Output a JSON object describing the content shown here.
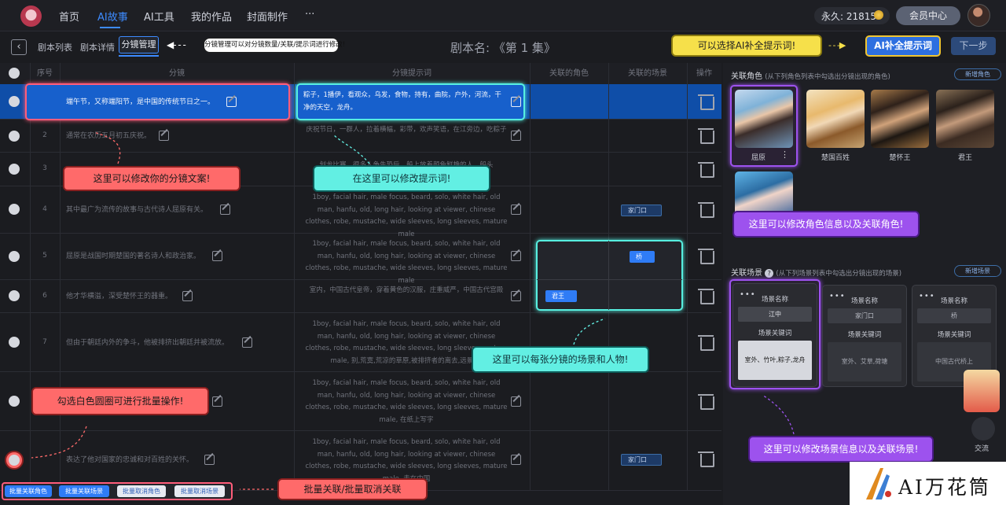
{
  "nav": {
    "items": [
      "首页",
      "AI故事",
      "AI工具",
      "我的作品",
      "封面制作",
      "···"
    ],
    "active_index": 1,
    "credits": "永久: 21815",
    "member_button": "会员中心"
  },
  "subnav": {
    "tabs": [
      "剧本列表",
      "剧本详情",
      "分镜管理"
    ],
    "active_tab": "分镜管理",
    "script_title": "剧本名: 《第 1 集》",
    "ai_button": "AI补全提示词",
    "next_button": "下一步"
  },
  "table": {
    "headers": [
      "序号",
      "分镜",
      "分镜提示词",
      "关联的角色",
      "关联的场景",
      "操作"
    ],
    "rows": [
      {
        "no": "1",
        "text": "端午节，又称端阳节，是中国的传统节日之一。",
        "prompt": "粽子，1播伊，看观众，乌发，食物，持有，曲院，户外，河流，干净的天空，龙舟。",
        "selected": true
      },
      {
        "no": "2",
        "text": "通常在农历五月初五庆祝。",
        "prompt": "庆祝节日，一群人，拉着横幅，彩带，欢声笑语，在江旁边，吃粽子"
      },
      {
        "no": "3",
        "text": "",
        "prompt": "划龙比赛，很多人争先恐后，船上放着颜色鲜艳的人，船头"
      },
      {
        "no": "4",
        "text": "其中最广为流传的故事与古代诗人屈原有关。",
        "prompt": "1boy, facial hair, male focus, beard, solo, white hair, old man, hanfu, old, long hair, looking at viewer, chinese clothes, robe, mustache, wide sleeves, long sleeves, mature male",
        "scene": "家门口"
      },
      {
        "no": "5",
        "text": "屈原是战国时期楚国的著名诗人和政治家。",
        "prompt": "1boy, facial hair, male focus, beard, solo, white hair, old man, hanfu, old, long hair, looking at viewer, chinese clothes, robe, mustache, wide sleeves, long sleeves, mature male",
        "scene": "桥"
      },
      {
        "no": "6",
        "text": "他才华横溢，深受楚怀王的器重。",
        "prompt": "室内，中国古代皇帝，穿着黄色的汉服，庄重威严，中国古代宫殿",
        "role": "君王"
      },
      {
        "no": "7",
        "text": "但由于朝廷内外的争斗，他被排挤出朝廷并被流放。",
        "prompt": "1boy, facial hair, male focus, beard, solo, white hair, old man, hanfu, old, long hair, looking at viewer, chinese clothes, robe, mustache, wide sleeves, long sleeves, mature male, 别,荒寞,荒凉的草原,被排挤者的离去,远景,昏"
      },
      {
        "no": "8",
        "text": "",
        "prompt": "1boy, facial hair, male focus, beard, solo, white hair, old man, hanfu, old, long hair, looking at viewer, chinese clothes, robe, mustache, wide sleeves, long sleeves, mature male, 在纸上写字"
      },
      {
        "no": "",
        "text": "表达了他对国家的忠诚和对百姓的关怀。",
        "prompt": "1boy, facial hair, male focus, beard, solo, white hair, old man, hanfu, old, long hair, looking at viewer, chinese clothes, robe, mustache, wide sleeves, long sleeves, mature male, 走在中国",
        "scene": "家门口"
      }
    ]
  },
  "batch_buttons": [
    "批量关联角色",
    "批量关联场景",
    "批量取消角色",
    "批量取消场景"
  ],
  "roles_panel": {
    "title": "关联角色",
    "hint": "(从下列角色列表中勾选出分镜出现的角色)",
    "add_button": "新增角色",
    "characters": [
      "屈原",
      "楚国百姓",
      "楚怀王",
      "君王"
    ]
  },
  "scenes_panel": {
    "title": "关联场景",
    "hint": "(从下列场景列表中勾选出分镜出现的场景)",
    "add_button": "新增场景",
    "name_label": "场景名称",
    "keyword_label": "场景关键词",
    "scenes": [
      {
        "name": "江中",
        "keywords": "室外、竹叶,粽子,龙舟"
      },
      {
        "name": "家门口",
        "keywords": "室外、艾草,荷塘"
      },
      {
        "name": "桥",
        "keywords": "中国古代桥上"
      }
    ]
  },
  "side": {
    "exchange_label": "交流"
  },
  "annotations": {
    "storyboard_tip": "分镜管理可以对分镜数量/关联/提示词进行修改!",
    "ai_tip": "可以选择AI补全提示词!",
    "edit_text": "这里可以修改你的分镜文案!",
    "edit_prompt": "在这里可以修改提示词!",
    "scene_role": "这里可以每张分镜的场景和人物!",
    "edit_role": "这里可以修改角色信息以及关联角色!",
    "batch_select": "勾选白色圆圈可进行批量操作!",
    "batch_link": "批量关联/批量取消关联",
    "edit_scene": "这里可以修改场景信息以及关联场景!"
  },
  "watermark": "AI万花筒",
  "colors": {
    "accent": "#3d8bff",
    "selected_row": "#0f4ea8",
    "annotation_red": "#ff6a6a",
    "annotation_cyan": "#62efe3",
    "annotation_purple": "#9d52ee",
    "annotation_yellow": "#f6e04a"
  }
}
